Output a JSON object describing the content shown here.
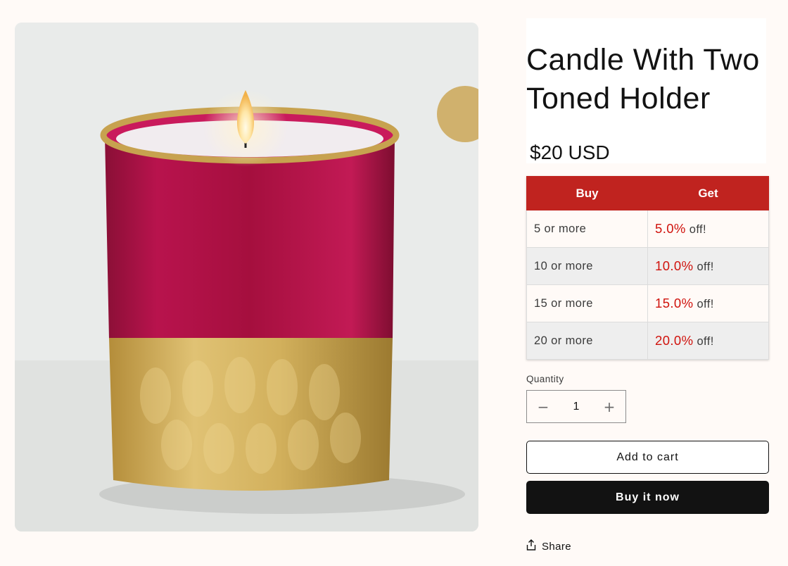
{
  "product": {
    "title_line1": "Candle With Two",
    "title_line2": "Toned Holder",
    "price": "$20 USD",
    "image_icon": "candle-product-image"
  },
  "discount_table": {
    "headers": {
      "buy": "Buy",
      "get": "Get"
    },
    "rows": [
      {
        "buy": "5 or more",
        "percent": "5.0%",
        "suffix": "off!"
      },
      {
        "buy": "10 or more",
        "percent": "10.0%",
        "suffix": "off!"
      },
      {
        "buy": "15 or more",
        "percent": "15.0%",
        "suffix": "off!"
      },
      {
        "buy": "20 or more",
        "percent": "20.0%",
        "suffix": "off!"
      }
    ],
    "colors": {
      "header_bg": "#c0231f",
      "percent_text": "#d0130d"
    }
  },
  "quantity": {
    "label": "Quantity",
    "value": "1",
    "decrease_icon": "minus-icon",
    "increase_icon": "plus-icon"
  },
  "actions": {
    "add_to_cart": "Add to cart",
    "buy_now": "Buy it now",
    "share": "Share",
    "share_icon": "share-icon"
  }
}
